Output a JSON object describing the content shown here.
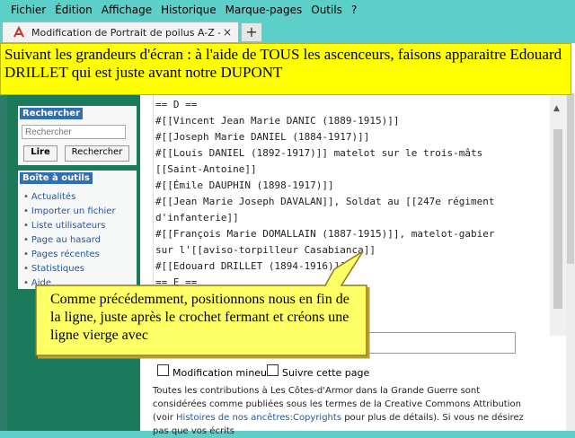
{
  "menubar": {
    "items": [
      "Fichier",
      "Édition",
      "Affichage",
      "Historique",
      "Marque-pages",
      "Outils",
      "?"
    ]
  },
  "tab": {
    "title": "Modification de Portrait de poilus A-Z - ...",
    "close": "×",
    "new_tab": "+"
  },
  "banner": {
    "text": "Suivant les grandeurs d'écran : à l'aide de TOUS les ascenceurs, faisons apparaitre Edouard DRILLET qui est juste avant notre DUPONT"
  },
  "sidebar": {
    "search": {
      "heading": "Rechercher",
      "placeholder": "Rechercher",
      "read_label": "Lire",
      "search_label": "Rechercher"
    },
    "tools": {
      "heading": "Boîte à outils",
      "items": [
        "Actualités",
        "Importer un fichier",
        "Liste utilisateurs",
        "Page au hasard",
        "Pages récentes",
        "Statistiques",
        "Aide"
      ]
    }
  },
  "editor": {
    "lines": [
      "== D ==",
      "#[[Vincent Jean Marie DANIC (1889-1915)]]",
      "#[[Joseph Marie DANIEL (1884-1917)]]",
      "#[[Louis DANIEL (1892-1917)]] matelot sur le trois-mâts",
      "[[Saint-Antoine]]",
      "#[[Émile DAUPHIN (1898-1917)]]",
      "#[[Jean Marie Joseph DAVALAN]], Soldat au [[247e régiment",
      "d'infanterie]]",
      "#[[François Marie DOMALLAIN (1887-1915)]], matelot-gabier",
      "sur l'[[aviso-torpilleur Casabianca]]",
      "#[[Edouard DRILLET (1894-1916)]]",
      "== E =="
    ]
  },
  "form": {
    "minor_edit_label": "Modification mineure",
    "watch_label": "Suivre cette page"
  },
  "license": {
    "text_before": "Toutes les contributions à Les Côtes-d'Armor dans la Grande Guerre sont considérées comme publiées sous les termes de la Creative Commons Attribution (voir ",
    "link": "Histoires de nos ancêtres:Copyrights",
    "text_after": " pour plus de détails). Si vous ne désirez pas que vos écrits"
  },
  "callout": {
    "text": "Comme précédemment, positionnons nous en fin de la ligne, juste après le crochet fermant et créons une ligne vierge avec"
  },
  "colors": {
    "banner": "#ffff00",
    "sidebar": "#1b7a5b",
    "chrome": "#5ccfc9",
    "link": "#2255aa"
  }
}
